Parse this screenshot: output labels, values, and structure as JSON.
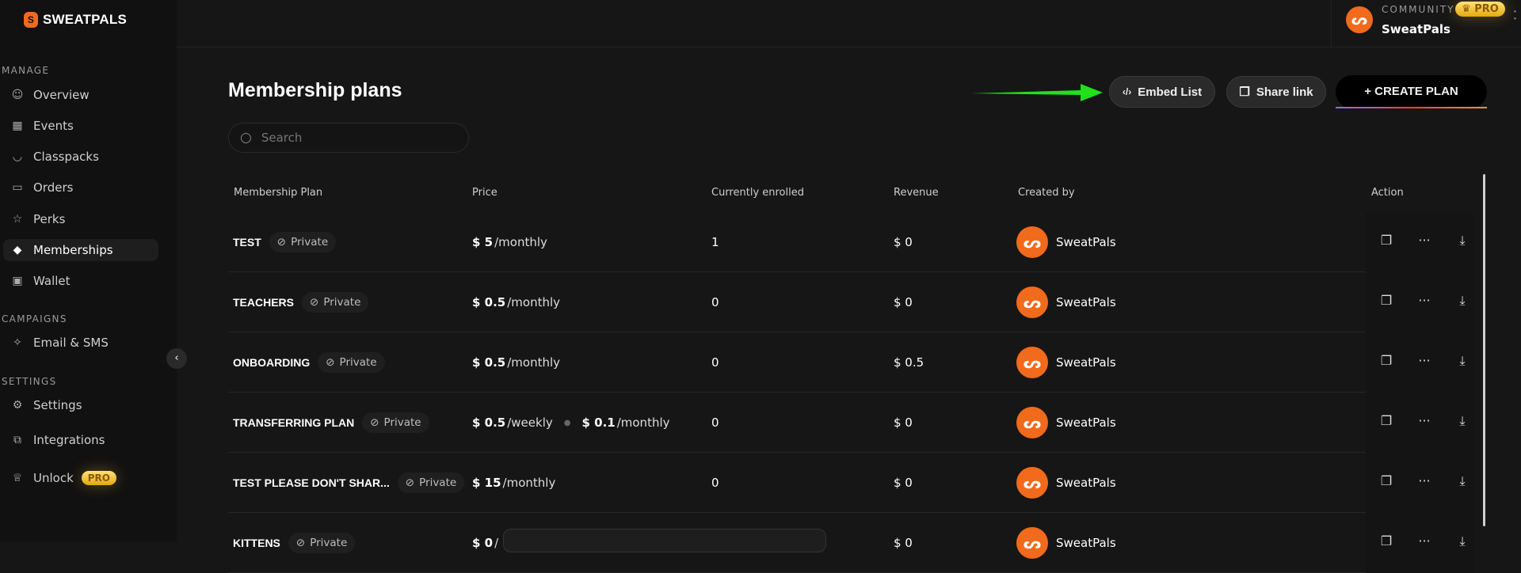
{
  "brand": {
    "name": "SWEATPALS",
    "accent": "#f26a1b"
  },
  "sidebar": {
    "sections": [
      {
        "label": "MANAGE"
      },
      {
        "label": "CAMPAIGNS"
      },
      {
        "label": "SETTINGS"
      }
    ],
    "items": [
      {
        "label": "Overview",
        "icon": "users-icon"
      },
      {
        "label": "Events",
        "icon": "calendar-icon"
      },
      {
        "label": "Classpacks",
        "icon": "package-icon"
      },
      {
        "label": "Orders",
        "icon": "ticket-icon"
      },
      {
        "label": "Perks",
        "icon": "star-icon"
      },
      {
        "label": "Memberships",
        "icon": "diamond-icon",
        "active": true
      },
      {
        "label": "Wallet",
        "icon": "wallet-icon"
      },
      {
        "label": "Email & SMS",
        "icon": "megaphone-icon"
      },
      {
        "label": "Settings",
        "icon": "gear-icon"
      },
      {
        "label": "Integrations",
        "icon": "integrations-icon"
      },
      {
        "label": "Unlock",
        "icon": "crown-icon",
        "badge": "PRO"
      }
    ]
  },
  "community": {
    "label": "COMMUNITY",
    "badge": "PRO",
    "name": "SweatPals"
  },
  "page": {
    "title": "Membership plans",
    "search_placeholder": "Search",
    "embed_label": "Embed List",
    "share_label": "Share link",
    "create_label": "+ CREATE PLAN"
  },
  "table": {
    "headers": [
      "Membership Plan",
      "Price",
      "Currently enrolled",
      "Revenue",
      "Created by",
      "Action"
    ],
    "rows": [
      {
        "name": "TEST",
        "badge": "Private",
        "price": [
          {
            "amount": "$ 5",
            "period": "/monthly"
          }
        ],
        "enrolled": "1",
        "revenue": "$ 0",
        "creator": "SweatPals"
      },
      {
        "name": "TEACHERS",
        "badge": "Private",
        "price": [
          {
            "amount": "$ 0.5",
            "period": "/monthly"
          }
        ],
        "enrolled": "0",
        "revenue": "$ 0",
        "creator": "SweatPals"
      },
      {
        "name": "ONBOARDING",
        "badge": "Private",
        "price": [
          {
            "amount": "$ 0.5",
            "period": "/monthly"
          }
        ],
        "enrolled": "0",
        "revenue": "$ 0.5",
        "creator": "SweatPals"
      },
      {
        "name": "TRANSFERRING PLAN",
        "badge": "Private",
        "price": [
          {
            "amount": "$ 0.5",
            "period": "/weekly"
          },
          {
            "amount": "$ 0.1",
            "period": "/monthly"
          }
        ],
        "enrolled": "0",
        "revenue": "$ 0",
        "creator": "SweatPals"
      },
      {
        "name": "TEST PLEASE DON'T SHAR...",
        "badge": "Private",
        "price": [
          {
            "amount": "$ 15",
            "period": "/monthly"
          }
        ],
        "enrolled": "0",
        "revenue": "$ 0",
        "creator": "SweatPals"
      },
      {
        "name": "KITTENS",
        "badge": "Private",
        "price": [
          {
            "amount": "$ 0",
            "period": "/"
          }
        ],
        "enrolled": "",
        "revenue": "$ 0",
        "creator": "SweatPals"
      }
    ]
  }
}
